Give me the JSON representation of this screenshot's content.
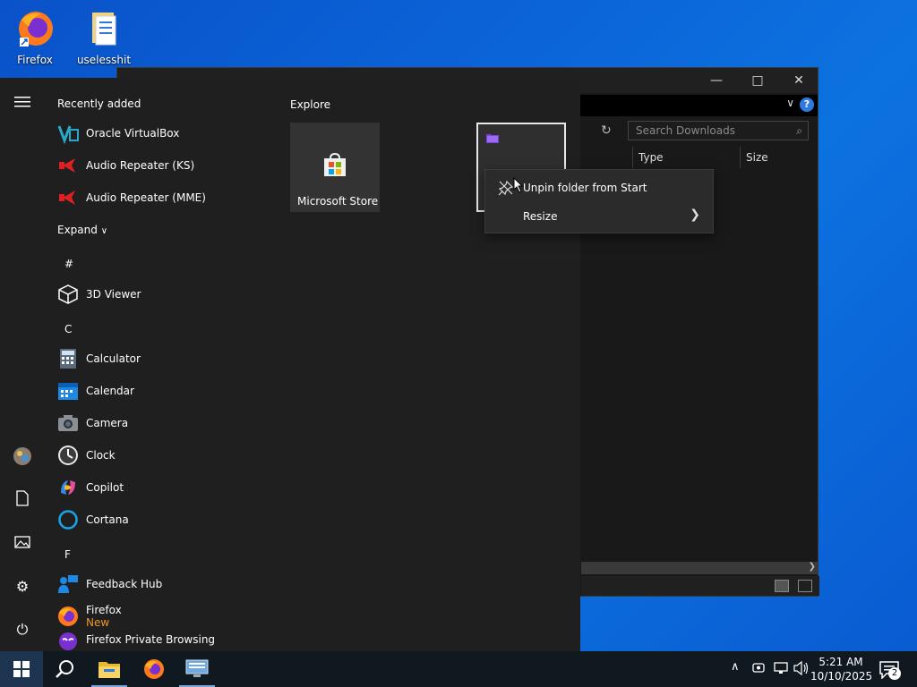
{
  "desktop": {
    "icons": [
      {
        "label": "Firefox",
        "icon": "firefox-icon"
      },
      {
        "label": "uselesshit",
        "icon": "folder-icon"
      }
    ]
  },
  "explorer": {
    "search_placeholder": "Search Downloads",
    "columns": [
      "Type",
      "Size"
    ],
    "help": "?"
  },
  "start_menu": {
    "recently_added": "Recently added",
    "recent_apps": [
      {
        "name": "Oracle VirtualBox",
        "icon": "virtualbox-icon"
      },
      {
        "name": "Audio Repeater (KS)",
        "icon": "audio-repeater-icon"
      },
      {
        "name": "Audio Repeater (MME)",
        "icon": "audio-repeater-icon"
      }
    ],
    "expand": "Expand",
    "letters": {
      "hash": "#",
      "c": "C",
      "f": "F"
    },
    "apps_hash": [
      {
        "name": "3D Viewer",
        "icon": "cube-icon"
      }
    ],
    "apps_c": [
      {
        "name": "Calculator",
        "icon": "calculator-icon"
      },
      {
        "name": "Calendar",
        "icon": "calendar-icon"
      },
      {
        "name": "Camera",
        "icon": "camera-icon"
      },
      {
        "name": "Clock",
        "icon": "clock-icon"
      },
      {
        "name": "Copilot",
        "icon": "copilot-icon"
      },
      {
        "name": "Cortana",
        "icon": "cortana-icon"
      }
    ],
    "apps_f": [
      {
        "name": "Feedback Hub",
        "icon": "feedback-hub-icon"
      },
      {
        "name": "Firefox",
        "sub": "New",
        "icon": "firefox-icon"
      },
      {
        "name": "Firefox Private Browsing",
        "icon": "firefox-private-icon"
      }
    ],
    "explore": "Explore",
    "tiles": [
      {
        "label": "Microsoft Store",
        "icon": "store-icon"
      }
    ]
  },
  "context_menu": {
    "unpin": "Unpin folder from Start",
    "resize": "Resize"
  },
  "taskbar": {
    "time": "5:21 AM",
    "date": "10/10/2025",
    "notifications": "2"
  },
  "colors": {
    "accent": "#0078d4",
    "start_bg": "#1f1f1f",
    "firefox_sub": "#e8962a"
  }
}
